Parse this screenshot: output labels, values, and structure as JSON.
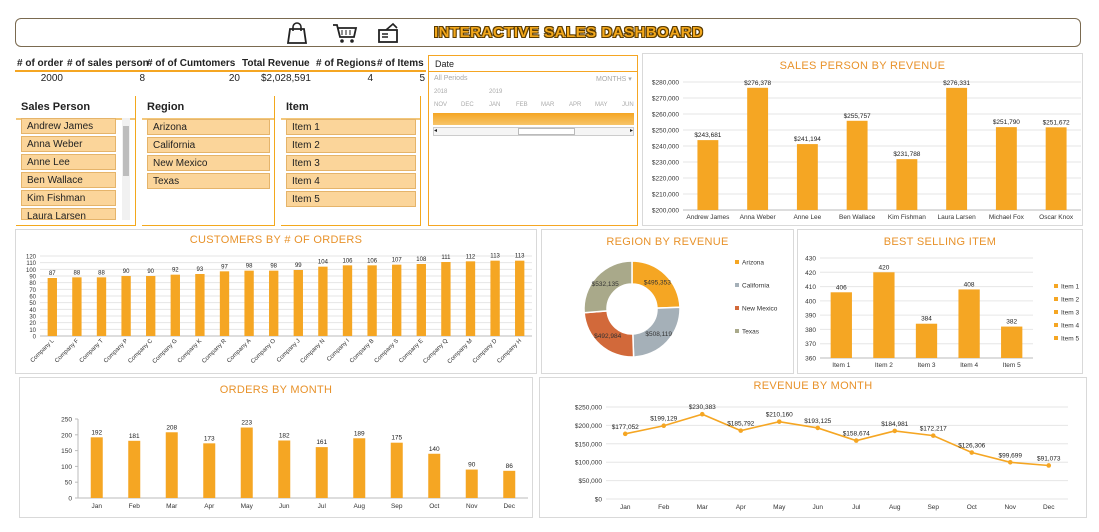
{
  "header": {
    "title": "INTERACTIVE SALES DASHBOARD",
    "icons": [
      "shopping-bag-icon",
      "shopping-cart-icon",
      "wallet-icon"
    ]
  },
  "kpis": [
    {
      "label": "# of order",
      "value": "2000"
    },
    {
      "label": "# of sales person",
      "value": "8"
    },
    {
      "label": "# of of Cumtomers",
      "value": "20"
    },
    {
      "label": "Total Revenue",
      "value": "$2,028,591"
    },
    {
      "label": "# of Regions",
      "value": "4"
    },
    {
      "label": "# of Items",
      "value": "5"
    }
  ],
  "slicers": {
    "sales_person": {
      "title": "Sales Person",
      "items": [
        "Andrew James",
        "Anna Weber",
        "Anne Lee",
        "Ben Wallace",
        "Kim Fishman",
        "Laura Larsen"
      ]
    },
    "region": {
      "title": "Region",
      "items": [
        "Arizona",
        "California",
        "New Mexico",
        "Texas"
      ]
    },
    "item": {
      "title": "Item",
      "items": [
        "Item 1",
        "Item 2",
        "Item 3",
        "Item 4",
        "Item 5"
      ]
    }
  },
  "timeline": {
    "title": "Date",
    "period_label": "All Periods",
    "unit_label": "MONTHS",
    "years": [
      "2018",
      "2019"
    ],
    "months": [
      "NOV",
      "DEC",
      "JAN",
      "FEB",
      "MAR",
      "APR",
      "MAY",
      "JUN"
    ]
  },
  "colors": {
    "accent": "#f5a623",
    "title": "#e8922a"
  },
  "chart_data": [
    {
      "id": "sales_person_revenue",
      "type": "bar",
      "title": "SALES PERSON BY REVENUE",
      "categories": [
        "Andrew James",
        "Anna Weber",
        "Anne Lee",
        "Ben Wallace",
        "Kim Fishman",
        "Laura Larsen",
        "Michael Fox",
        "Oscar Knox"
      ],
      "values": [
        243681,
        276378,
        241194,
        255757,
        231788,
        276331,
        251790,
        251672
      ],
      "value_labels": [
        "$243,681",
        "$276,378",
        "$241,194",
        "$255,757",
        "$231,788",
        "$276,331",
        "$251,790",
        "$251,672"
      ],
      "ylim": [
        200000,
        280000
      ],
      "yticks": [
        "$200,000",
        "$210,000",
        "$220,000",
        "$230,000",
        "$240,000",
        "$250,000",
        "$260,000",
        "$270,000",
        "$280,000"
      ]
    },
    {
      "id": "customers_orders",
      "type": "bar",
      "title": "CUSTOMERS BY # OF ORDERS",
      "categories": [
        "Company L",
        "Company F",
        "Company T",
        "Company P",
        "Company C",
        "Company G",
        "Company K",
        "Company R",
        "Company A",
        "Company O",
        "Company J",
        "Company N",
        "Company I",
        "Company B",
        "Company S",
        "Company E",
        "Company Q",
        "Company M",
        "Company D",
        "Company H"
      ],
      "values": [
        87,
        88,
        88,
        90,
        90,
        92,
        93,
        97,
        98,
        98,
        99,
        104,
        106,
        106,
        107,
        108,
        111,
        112,
        113,
        113
      ],
      "ylim": [
        0,
        120
      ],
      "yticks": [
        "0",
        "10",
        "20",
        "30",
        "40",
        "50",
        "60",
        "70",
        "80",
        "90",
        "100",
        "110",
        "120"
      ]
    },
    {
      "id": "region_revenue",
      "type": "pie",
      "title": "REGION BY REVENUE",
      "categories": [
        "Arizona",
        "California",
        "New Mexico",
        "Texas"
      ],
      "values": [
        495353,
        508119,
        492984,
        532135
      ],
      "value_labels": [
        "$495,353",
        "$508,119",
        "$492,984",
        "$532,135"
      ],
      "colors": [
        "#f5a623",
        "#a5b0b8",
        "#d2693a",
        "#a9a98a"
      ],
      "legend": "right"
    },
    {
      "id": "best_selling_item",
      "type": "bar",
      "title": "BEST SELLING ITEM",
      "categories": [
        "Item 1",
        "Item 2",
        "Item 3",
        "Item 4",
        "Item 5"
      ],
      "values": [
        406,
        420,
        384,
        408,
        382
      ],
      "ylim": [
        360,
        430
      ],
      "yticks": [
        "360",
        "370",
        "380",
        "390",
        "400",
        "410",
        "420",
        "430"
      ],
      "legend": "right"
    },
    {
      "id": "orders_month",
      "type": "bar",
      "title": "ORDERS BY MONTH",
      "categories": [
        "Jan",
        "Feb",
        "Mar",
        "Apr",
        "May",
        "Jun",
        "Jul",
        "Aug",
        "Sep",
        "Oct",
        "Nov",
        "Dec"
      ],
      "values": [
        192,
        181,
        208,
        173,
        223,
        182,
        161,
        189,
        175,
        140,
        90,
        86
      ],
      "ylim": [
        0,
        250
      ],
      "yticks": [
        "0",
        "50",
        "100",
        "150",
        "200",
        "250"
      ]
    },
    {
      "id": "revenue_month",
      "type": "line",
      "title": "REVENUE BY MONTH",
      "categories": [
        "Jan",
        "Feb",
        "Mar",
        "Apr",
        "May",
        "Jun",
        "Jul",
        "Aug",
        "Sep",
        "Oct",
        "Nov",
        "Dec"
      ],
      "values": [
        177052,
        199129,
        230383,
        185792,
        210160,
        193125,
        158674,
        184981,
        172217,
        126306,
        99699,
        91073
      ],
      "value_labels": [
        "$177,052",
        "$199,129",
        "$230,383",
        "$185,792",
        "$210,160",
        "$193,125",
        "$158,674",
        "$184,981",
        "$172,217",
        "$126,306",
        "$99,699",
        "$91,073"
      ],
      "ylim": [
        0,
        250000
      ],
      "yticks": [
        "$0",
        "$50,000",
        "$100,000",
        "$150,000",
        "$200,000",
        "$250,000"
      ]
    }
  ]
}
